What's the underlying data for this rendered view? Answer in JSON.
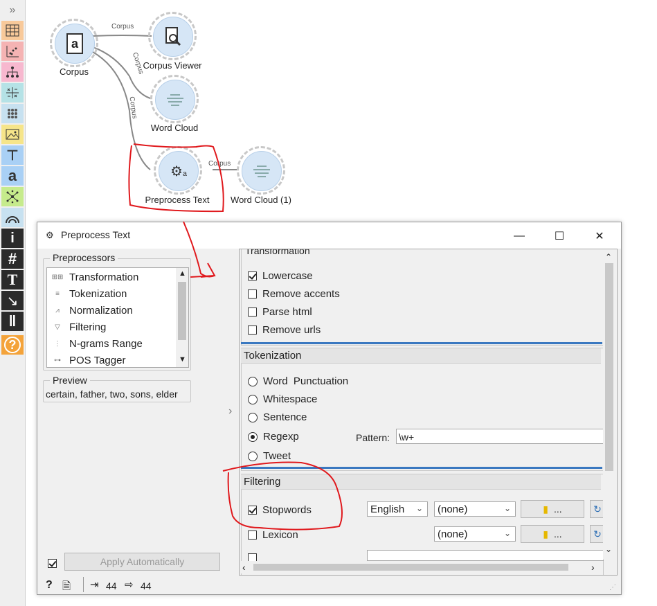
{
  "workflow": {
    "nodes": [
      {
        "id": "corpus",
        "label": "Corpus",
        "icon": "document-a-icon"
      },
      {
        "id": "corpus_viewer",
        "label": "Corpus Viewer",
        "icon": "magnifier-document-icon"
      },
      {
        "id": "word_cloud",
        "label": "Word Cloud",
        "icon": "word-cloud-icon"
      },
      {
        "id": "preprocess_text",
        "label": "Preprocess Text",
        "icon": "gears-icon"
      },
      {
        "id": "word_cloud_1",
        "label": "Word Cloud (1)",
        "icon": "word-cloud-icon"
      }
    ],
    "link_labels": {
      "l1": "Corpus",
      "l2": "Corpus",
      "l3": "Corpus",
      "l4": "Corpus"
    }
  },
  "toolbox": {
    "items": [
      {
        "name": "collapse",
        "glyph": "»"
      },
      {
        "name": "data",
        "glyph": "▦"
      },
      {
        "name": "visualize",
        "glyph": "⁘"
      },
      {
        "name": "model",
        "glyph": "⋔"
      },
      {
        "name": "evaluate",
        "glyph": "⊞"
      },
      {
        "name": "unsupervised",
        "glyph": "⁙"
      },
      {
        "name": "image",
        "glyph": "▣"
      },
      {
        "name": "text-input",
        "glyph": "T"
      },
      {
        "name": "text-mining",
        "glyph": "a"
      },
      {
        "name": "network",
        "glyph": "✲"
      },
      {
        "name": "spectroscopy",
        "glyph": "◠"
      },
      {
        "name": "info",
        "glyph": "i"
      },
      {
        "name": "hash",
        "glyph": "#"
      },
      {
        "name": "text-tool",
        "glyph": "T"
      },
      {
        "name": "arrow-tool",
        "glyph": "↘"
      },
      {
        "name": "pause",
        "glyph": "‖"
      },
      {
        "name": "help",
        "glyph": "?"
      }
    ],
    "colors": {
      "data": "#f8c99a",
      "visualize": "#f5b3b3",
      "model": "#f7b8cf",
      "evaluate": "#b5e2e6",
      "unsupervised": "#c7e1f0",
      "image": "#f6e58a",
      "text": "#a9d0f5",
      "network": "#c6eb8c",
      "help": "#f4a33a"
    }
  },
  "dialog": {
    "title": "Preprocess Text",
    "controls": {
      "minimize": "—",
      "maximize": "☐",
      "close": "✕"
    },
    "preprocessors": {
      "title": "Preprocessors",
      "items": [
        {
          "label": "Transformation",
          "icon": "transformation-icon"
        },
        {
          "label": "Tokenization",
          "icon": "tokenization-icon"
        },
        {
          "label": "Normalization",
          "icon": "normalization-icon"
        },
        {
          "label": "Filtering",
          "icon": "filter-icon"
        },
        {
          "label": "N-grams Range",
          "icon": "ngrams-icon"
        },
        {
          "label": "POS Tagger",
          "icon": "pos-tagger-icon"
        }
      ]
    },
    "preview": {
      "title": "Preview",
      "text": "certain, father, two, sons, elder"
    },
    "apply_automatically": {
      "label": "Apply Automatically",
      "checked": true
    },
    "status": {
      "input_count": "44",
      "output_count": "44"
    },
    "transformation": {
      "title": "Transformation",
      "options": [
        {
          "label": "Lowercase",
          "checked": true
        },
        {
          "label": "Remove accents",
          "checked": false
        },
        {
          "label": "Parse html",
          "checked": false
        },
        {
          "label": "Remove urls",
          "checked": false
        }
      ]
    },
    "tokenization": {
      "title": "Tokenization",
      "options": [
        {
          "label": "Word  Punctuation",
          "checked": false
        },
        {
          "label": "Whitespace",
          "checked": false
        },
        {
          "label": "Sentence",
          "checked": false
        },
        {
          "label": "Regexp",
          "checked": true
        },
        {
          "label": "Tweet",
          "checked": false
        }
      ],
      "pattern_label": "Pattern:",
      "pattern_value": "\\w+"
    },
    "filtering": {
      "title": "Filtering",
      "stopwords": {
        "label": "Stopwords",
        "checked": true,
        "language": "English",
        "file": "(none)",
        "browse": "..."
      },
      "lexicon": {
        "label": "Lexicon",
        "checked": false,
        "file": "(none)",
        "browse": "..."
      }
    }
  },
  "annotation_color": "#e0191d"
}
